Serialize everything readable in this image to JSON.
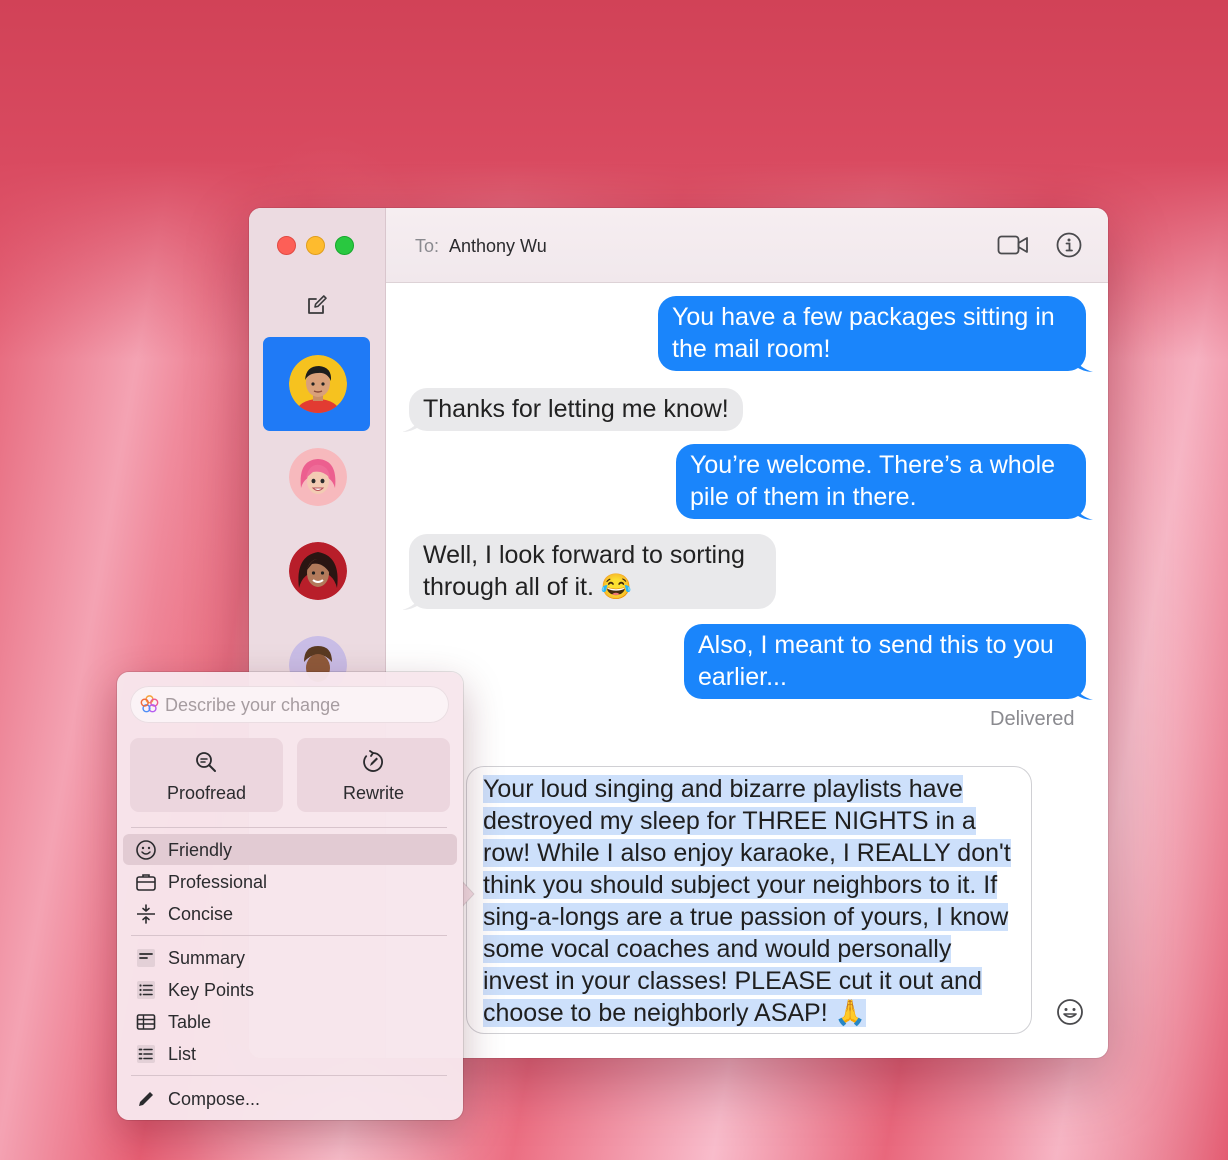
{
  "header": {
    "to_label": "To:",
    "recipient": "Anthony Wu"
  },
  "messages": [
    {
      "direction": "out",
      "text": "You have a few packages sitting in the mail room!"
    },
    {
      "direction": "in",
      "text": "Thanks for letting me know!"
    },
    {
      "direction": "out",
      "text": "You’re welcome. There’s a whole pile of them in there."
    },
    {
      "direction": "in",
      "text": "Well, I look forward to sorting through all of it. 😂"
    },
    {
      "direction": "out",
      "text": "Also, I meant to send this to you earlier..."
    }
  ],
  "status": "Delivered",
  "draft": "Your loud singing and bizarre playlists have destroyed my sleep for THREE NIGHTS in a row! While I also enjoy karaoke, I REALLY don't think you should subject your neighbors to it. If sing-a-longs are a true passion of yours, I know some vocal coaches and would personally invest in your classes! PLEASE cut it out and choose to be neighborly ASAP! 🙏",
  "writing_tools": {
    "placeholder": "Describe your change",
    "proofread": "Proofread",
    "rewrite": "Rewrite",
    "tone": [
      "Friendly",
      "Professional",
      "Concise"
    ],
    "format": [
      "Summary",
      "Key Points",
      "Table",
      "List"
    ],
    "compose": "Compose..."
  },
  "colors": {
    "accent": "#1a85fb",
    "incoming_bubble": "#e9e9eb",
    "selection": "#cde0fb"
  },
  "icons": [
    "compose-icon",
    "video-call-icon",
    "info-icon",
    "emoji-icon",
    "proofread-icon",
    "rewrite-icon",
    "smiley-icon",
    "briefcase-icon",
    "concise-icon",
    "summary-icon",
    "key-points-icon",
    "table-icon",
    "list-icon",
    "pencil-icon",
    "apple-intelligence-icon"
  ]
}
